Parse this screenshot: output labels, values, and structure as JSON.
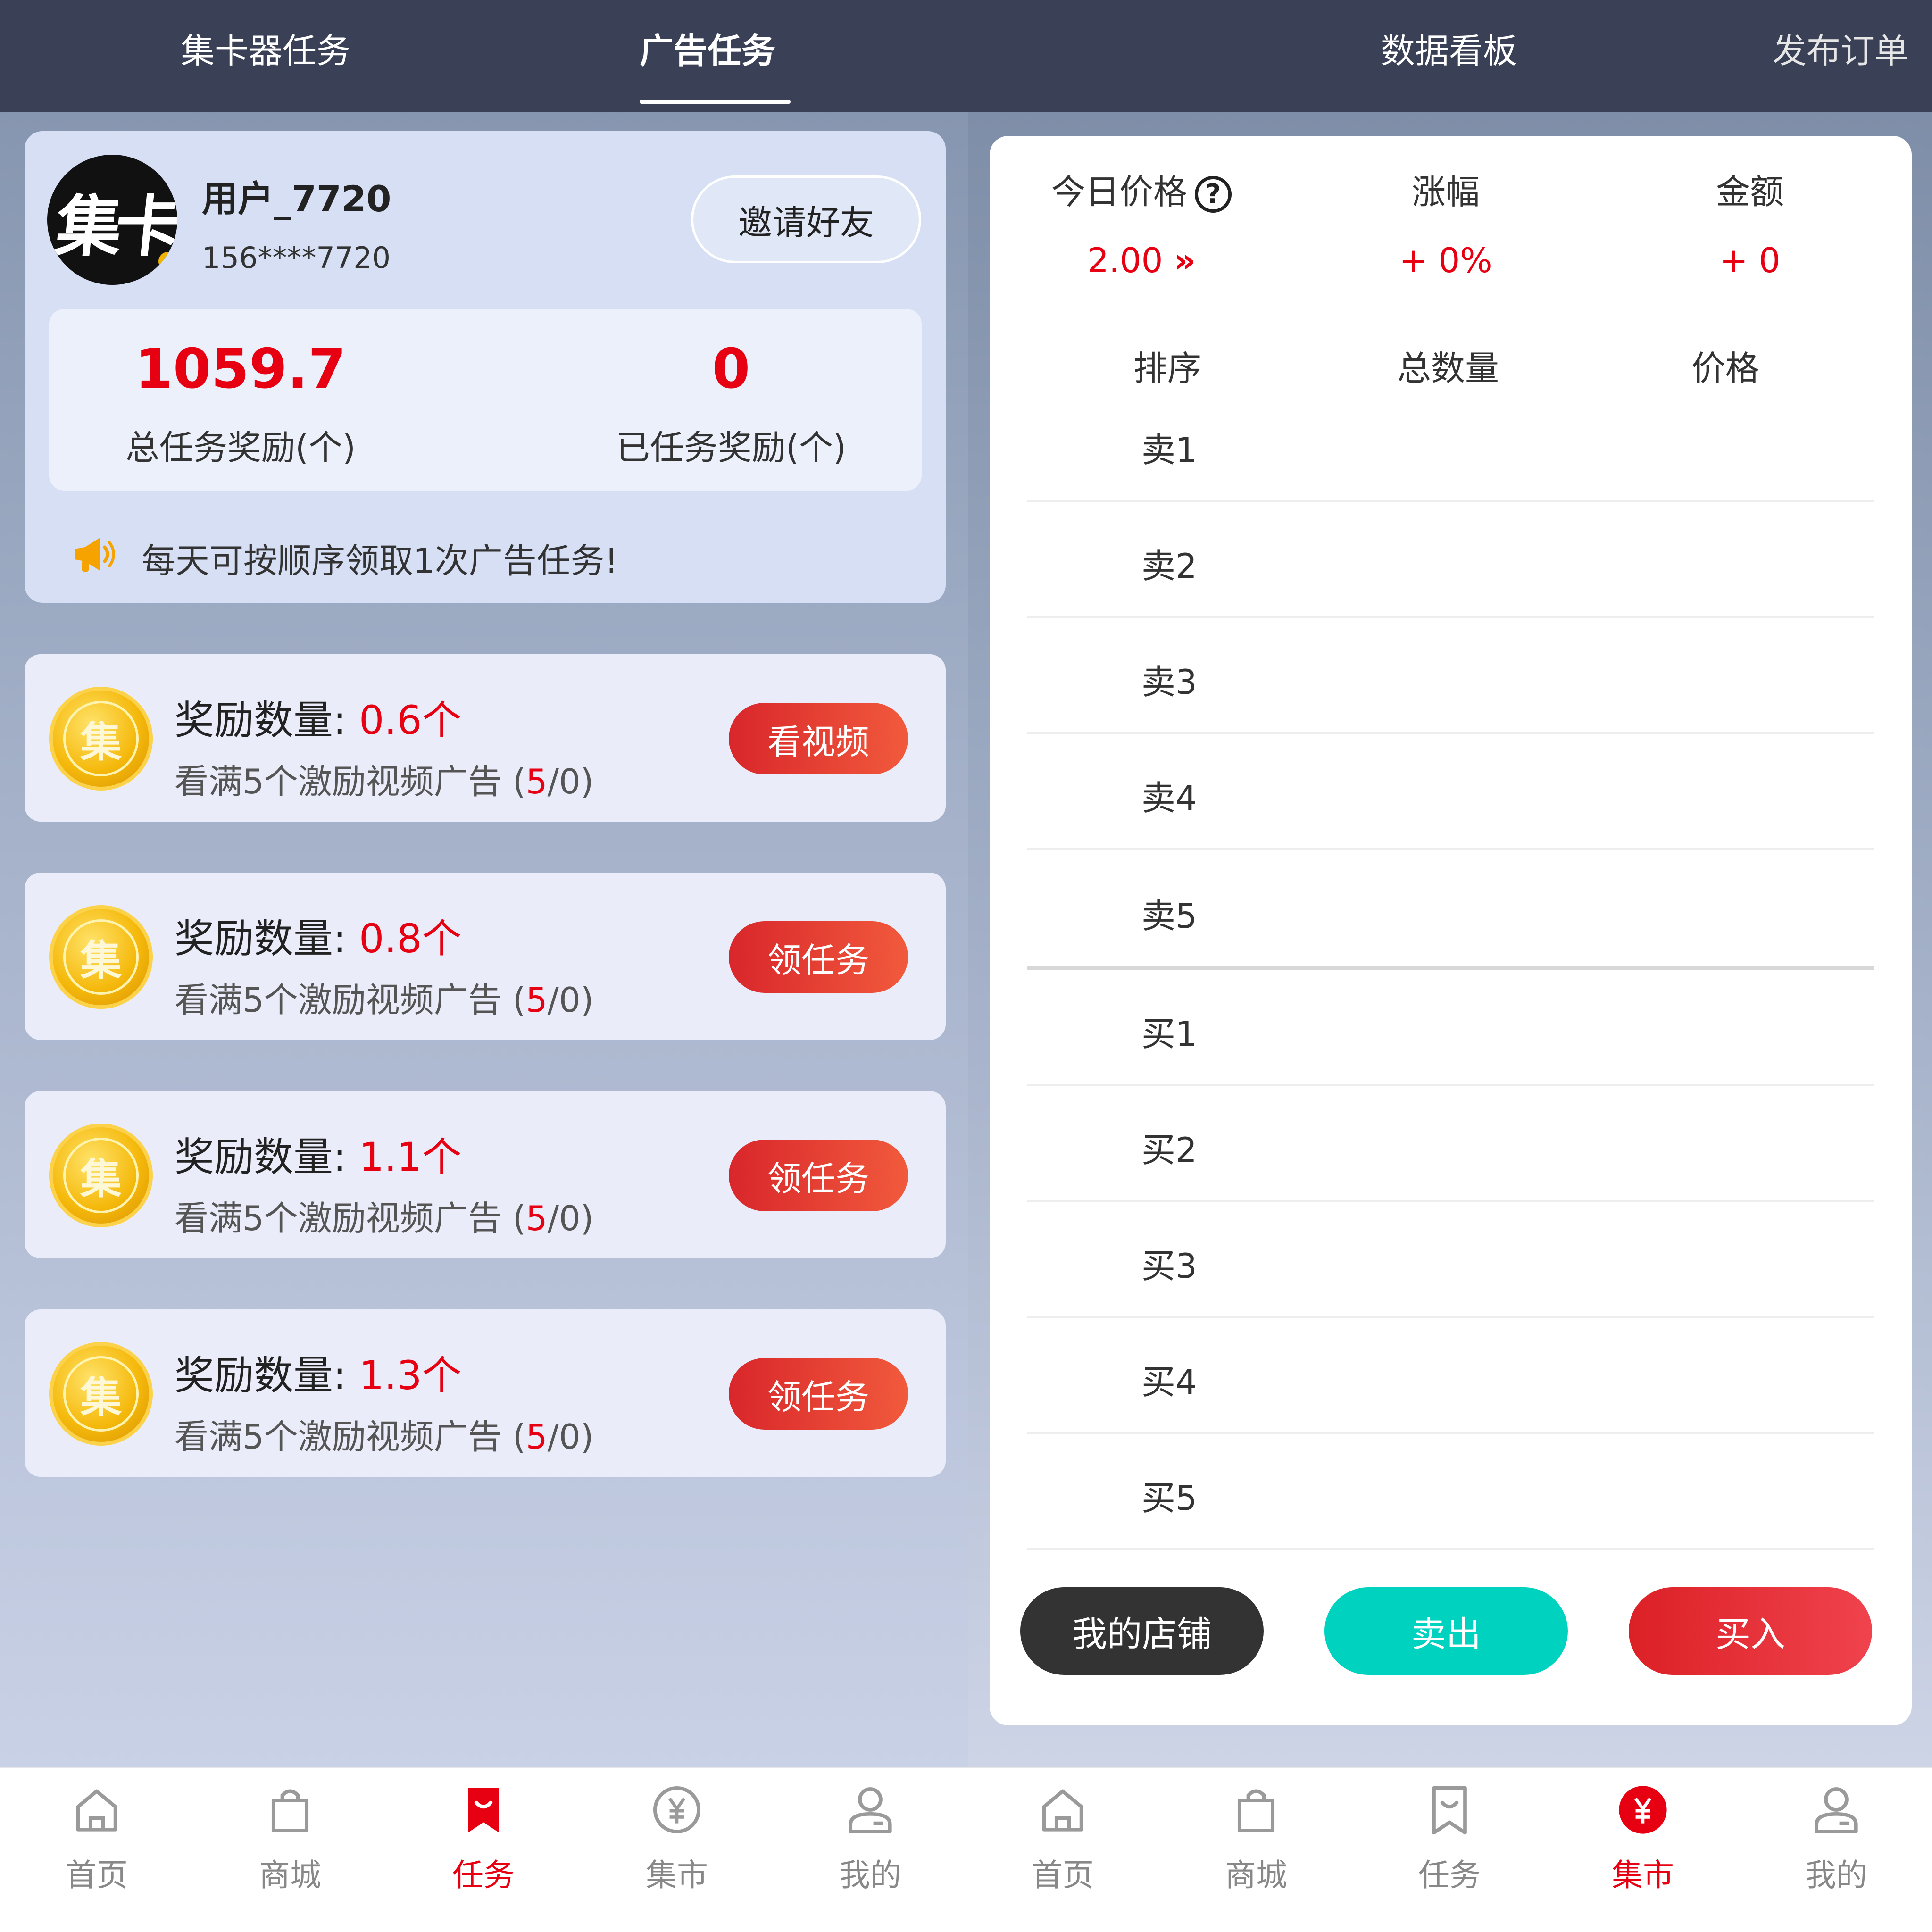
{
  "left": {
    "tabs": [
      {
        "label": "集卡器任务"
      },
      {
        "label": "广告任务"
      }
    ],
    "profile": {
      "avatar_text": "集卡",
      "username": "用户_7720",
      "phone": "156****7720",
      "invite_label": "邀请好友",
      "total_value": "1059.7",
      "total_label": "总任务奖励(个)",
      "done_value": "0",
      "done_label": "已任务奖励(个)",
      "notice": "每天可按顺序领取1次广告任务!"
    },
    "tasks": [
      {
        "reward_label": "奖励数量:",
        "reward": "0.6个",
        "sub_text": "看满5个激励视频广告 (",
        "sub_count": "5",
        "sub_tail": "/0)",
        "button": "看视频"
      },
      {
        "reward_label": "奖励数量:",
        "reward": "0.8个",
        "sub_text": "看满5个激励视频广告 (",
        "sub_count": "5",
        "sub_tail": "/0)",
        "button": "领任务"
      },
      {
        "reward_label": "奖励数量:",
        "reward": "1.1个",
        "sub_text": "看满5个激励视频广告 (",
        "sub_count": "5",
        "sub_tail": "/0)",
        "button": "领任务"
      },
      {
        "reward_label": "奖励数量:",
        "reward": "1.3个",
        "sub_text": "看满5个激励视频广告 (",
        "sub_count": "5",
        "sub_tail": "/0)",
        "button": "领任务"
      }
    ],
    "coin_char": "集"
  },
  "right": {
    "tabs": [
      {
        "label": "数据看板"
      },
      {
        "label": "发布订单"
      }
    ],
    "market": {
      "price_label": "今日价格",
      "help_glyph": "?",
      "price_value": "2.00",
      "price_arrow": "»",
      "change_label": "涨幅",
      "change_value": "+ 0%",
      "amount_label": "金额",
      "amount_value": "+ 0",
      "col_rank": "排序",
      "col_total": "总数量",
      "col_price": "价格",
      "sell_rows": [
        "卖1",
        "卖2",
        "卖3",
        "卖4",
        "卖5"
      ],
      "buy_rows": [
        "买1",
        "买2",
        "买3",
        "买4",
        "买5"
      ],
      "btn_shop": "我的店铺",
      "btn_sell": "卖出",
      "btn_buy": "买入"
    }
  },
  "nav": [
    {
      "label": "首页",
      "icon": "home-icon"
    },
    {
      "label": "商城",
      "icon": "bag-icon"
    },
    {
      "label": "任务",
      "icon": "bookmark-icon"
    },
    {
      "label": "集市",
      "icon": "yuan-coin-icon"
    },
    {
      "label": "我的",
      "icon": "user-icon"
    }
  ],
  "nav_active": {
    "left": "任务",
    "right": "集市"
  },
  "colors": {
    "accent_red": "#e60012",
    "topbar": "#3a4056",
    "sell_button": "#00d2c0",
    "shop_button": "#333333",
    "buy_button": "#e0262d"
  }
}
